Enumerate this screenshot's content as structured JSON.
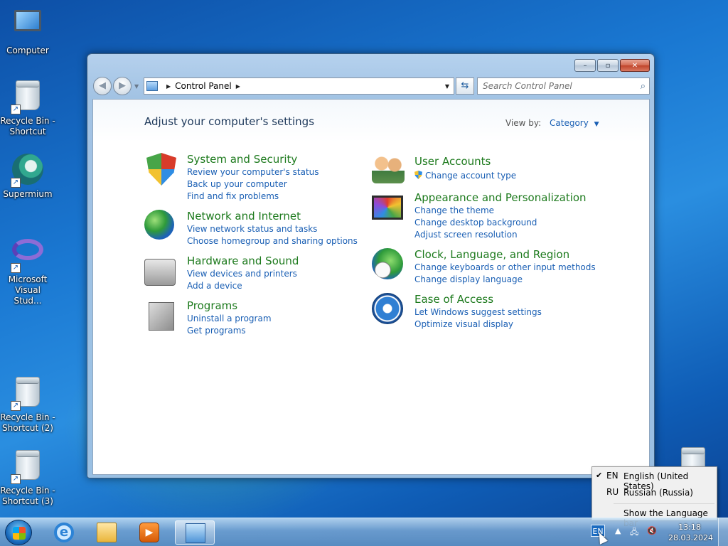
{
  "desktop": {
    "icons": [
      {
        "label": "Computer",
        "icon": "computer-icon"
      },
      {
        "label": "Recycle Bin - Shortcut",
        "icon": "recycle-bin-icon"
      },
      {
        "label": "Supermium",
        "icon": "supermium-icon"
      },
      {
        "label": "Microsoft Visual Stud...",
        "icon": "visual-studio-icon"
      },
      {
        "label": "Recycle Bin - Shortcut (2)",
        "icon": "recycle-bin-icon"
      },
      {
        "label": "Recycle Bin - Shortcut (3)",
        "icon": "recycle-bin-icon"
      }
    ]
  },
  "window": {
    "controls": {
      "minimize": "–",
      "maximize": "▫",
      "close": "✕"
    },
    "address": {
      "crumb": "Control Panel",
      "separator": "▶"
    },
    "refresh_icon": "⇆",
    "search": {
      "placeholder": "Search Control Panel",
      "icon": "⌕"
    },
    "nav": {
      "back": "◀",
      "forward": "▶"
    }
  },
  "content": {
    "title": "Adjust your computer's settings",
    "view_by_label": "View by:",
    "view_by_value": "Category",
    "categories": [
      {
        "title": "System and Security",
        "icon": "security-shield-icon",
        "links": [
          "Review your computer's status",
          "Back up your computer",
          "Find and fix problems"
        ]
      },
      {
        "title": "Network and Internet",
        "icon": "network-globe-icon",
        "links": [
          "View network status and tasks",
          "Choose homegroup and sharing options"
        ]
      },
      {
        "title": "Hardware and Sound",
        "icon": "printer-icon",
        "links": [
          "View devices and printers",
          "Add a device"
        ]
      },
      {
        "title": "Programs",
        "icon": "programs-box-icon",
        "links": [
          "Uninstall a program",
          "Get programs"
        ]
      },
      {
        "title": "User Accounts",
        "icon": "users-icon",
        "links": [
          "Change account type"
        ]
      },
      {
        "title": "Appearance and Personalization",
        "icon": "display-icon",
        "links": [
          "Change the theme",
          "Change desktop background",
          "Adjust screen resolution"
        ]
      },
      {
        "title": "Clock, Language, and Region",
        "icon": "clock-globe-icon",
        "links": [
          "Change keyboards or other input methods",
          "Change display language"
        ]
      },
      {
        "title": "Ease of Access",
        "icon": "ease-of-access-icon",
        "links": [
          "Let Windows suggest settings",
          "Optimize visual display"
        ]
      }
    ]
  },
  "language_menu": {
    "items": [
      {
        "check": "✔",
        "code": "EN",
        "name": "English (United States)"
      },
      {
        "check": "",
        "code": "RU",
        "name": "Russian (Russia)"
      }
    ],
    "show_bar": "Show the Language bar"
  },
  "taskbar": {
    "lang_indicator": "EN",
    "time": "13:18",
    "date": "28.03.2024",
    "tray_arrow": "▲"
  }
}
